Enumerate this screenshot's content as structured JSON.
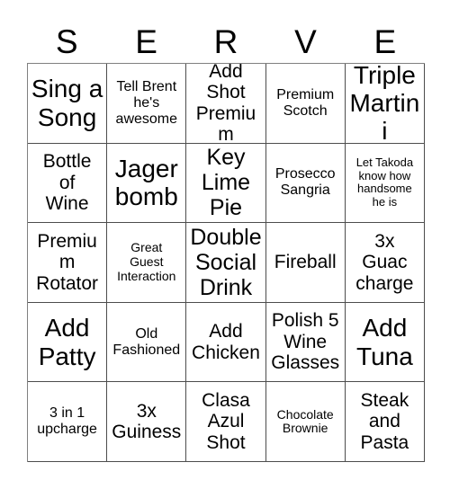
{
  "card": {
    "header_letters": [
      "S",
      "E",
      "R",
      "V",
      "E"
    ],
    "columns": 5,
    "rows": 5,
    "grid_line_color": "#4d4d4d",
    "background_color": "#ffffff",
    "text_color": "#000000",
    "cells": [
      {
        "text": "Sing a\nSong",
        "size": "xl"
      },
      {
        "text": "Tell Brent\nhe's\nawesome",
        "size": "sm"
      },
      {
        "text": "Add\nShot\nPremium",
        "size": "md"
      },
      {
        "text": "Premium\nScotch",
        "size": "sm"
      },
      {
        "text": "Triple\nMartini",
        "size": "xl"
      },
      {
        "text": "Bottle\nof\nWine",
        "size": "md"
      },
      {
        "text": "Jager\nbomb",
        "size": "xl"
      },
      {
        "text": "Key\nLime\nPie",
        "size": "lg"
      },
      {
        "text": "Prosecco\nSangria",
        "size": "sm"
      },
      {
        "text": "Let Takoda\nknow how\nhandsome\nhe is",
        "size": "xxs"
      },
      {
        "text": "Premium\nRotator",
        "size": "md"
      },
      {
        "text": "Great\nGuest\nInteraction",
        "size": "xs"
      },
      {
        "text": "Double\nSocial\nDrink",
        "size": "lg"
      },
      {
        "text": "Fireball",
        "size": "md"
      },
      {
        "text": "3x\nGuac\ncharge",
        "size": "md"
      },
      {
        "text": "Add\nPatty",
        "size": "xl"
      },
      {
        "text": "Old\nFashioned",
        "size": "sm"
      },
      {
        "text": "Add\nChicken",
        "size": "md"
      },
      {
        "text": "Polish 5\nWine\nGlasses",
        "size": "md"
      },
      {
        "text": "Add\nTuna",
        "size": "xl"
      },
      {
        "text": "3 in 1\nupcharge",
        "size": "sm"
      },
      {
        "text": "3x\nGuiness",
        "size": "md"
      },
      {
        "text": "Clasa\nAzul\nShot",
        "size": "md"
      },
      {
        "text": "Chocolate\nBrownie",
        "size": "xs"
      },
      {
        "text": "Steak\nand\nPasta",
        "size": "md"
      }
    ]
  }
}
